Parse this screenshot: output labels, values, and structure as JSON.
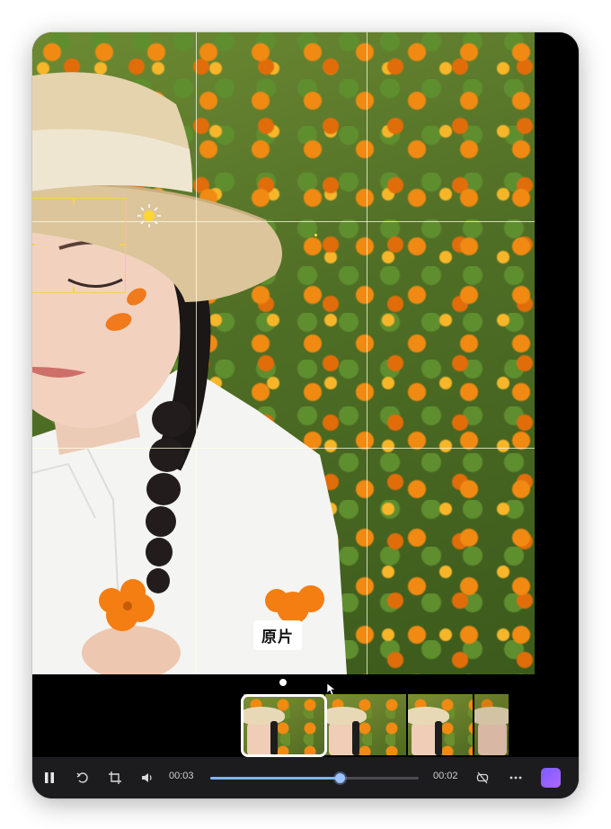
{
  "preview": {
    "overlay_label": "原片"
  },
  "controls": {
    "current_time": "00:03",
    "total_time": "00:02",
    "progress_fraction": 0.62,
    "icons": [
      "pause-icon",
      "rotate-left-icon",
      "crop-icon",
      "volume-icon",
      "loop-off-icon",
      "more-icon",
      "app-icon"
    ]
  },
  "timeline": {
    "thumbnail_count": 4,
    "selected_index": 0
  },
  "colors": {
    "accent": "#7fb3ff",
    "focus_box": "#f5d24a",
    "control_bar_bg": "#1c1c1f"
  }
}
